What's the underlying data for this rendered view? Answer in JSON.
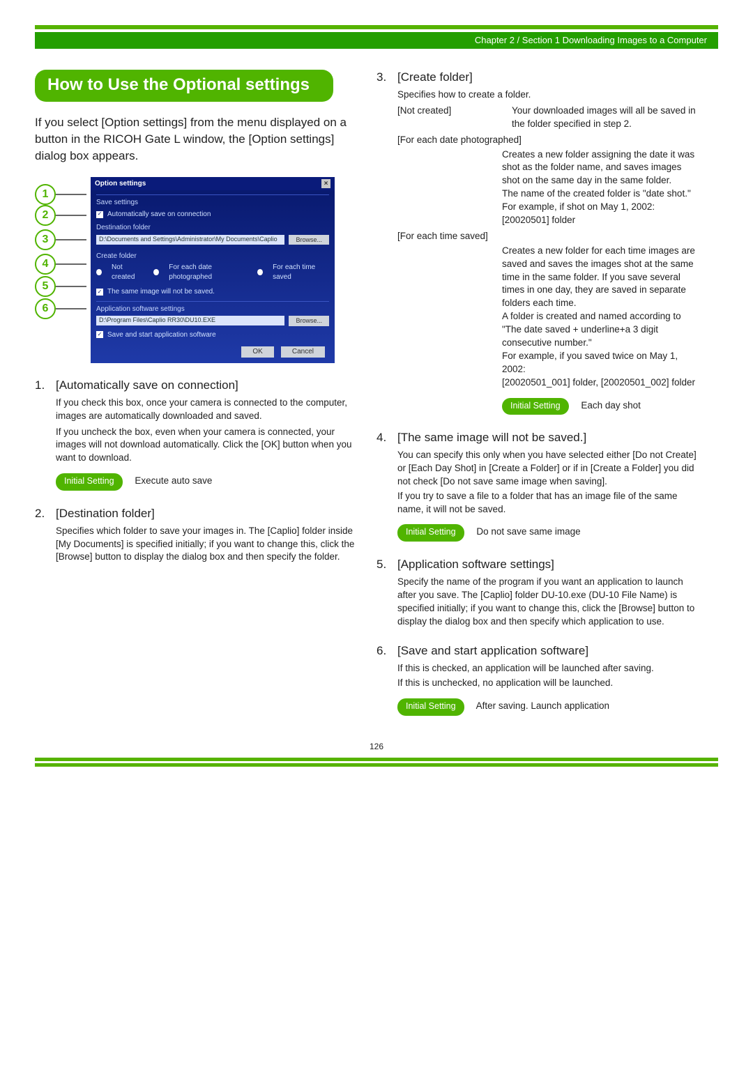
{
  "header": {
    "breadcrumb": "Chapter 2 / Section 1  Downloading Images to a Computer"
  },
  "sectionTitle": "How to Use the Optional settings",
  "intro": "If you select [Option settings] from the menu displayed on a button in the RICOH Gate L window, the [Option settings] dialog box appears.",
  "dialog": {
    "title": "Option settings",
    "groups": {
      "save": {
        "label": "Save settings",
        "autoSave": "Automatically save on connection",
        "destLabel": "Destination folder",
        "destPath": "D:\\Documents and Settings\\Administrator\\My Documents\\Caplio",
        "browse1": "Browse...",
        "createLabel": "Create folder",
        "opt1": "Not created",
        "opt2": "For each date photographed",
        "opt3": "For each time saved",
        "sameImage": "The same image will not be saved."
      },
      "app": {
        "label": "Application software settings",
        "appPath": "D:\\Program Files\\Caplio RR30\\DU10.EXE",
        "browse2": "Browse...",
        "saveStart": "Save and start application software"
      }
    },
    "ok": "OK",
    "cancel": "Cancel"
  },
  "callouts": [
    "1",
    "2",
    "3",
    "4",
    "5",
    "6"
  ],
  "initialSettingLabel": "Initial Setting",
  "left": {
    "item1": {
      "title": "[Automatically save on connection]",
      "p1": "If you check this box, once your camera is connected to the computer, images are automatically downloaded and saved.",
      "p2": "If you uncheck the box, even when your camera is connected, your images will not download automatically. Click the [OK] button when you want to download.",
      "initial": "Execute auto save"
    },
    "item2": {
      "title": "[Destination folder]",
      "p1": "Specifies which folder to save your images in. The [Caplio] folder inside [My Documents] is specified initially; if you want to change this, click the [Browse] button to display the dialog box and then specify the folder."
    }
  },
  "right": {
    "item3": {
      "title": "[Create folder]",
      "lead": "Specifies how to create a folder.",
      "not_created_term": "[Not created]",
      "not_created_desc": "Your downloaded images will all be saved in the folder specified in step 2.",
      "each_date_term": "[For each date photographed]",
      "each_date_desc": "Creates a new folder assigning the date it was shot as the folder name, and saves images shot on the same day in the same folder.\nThe name of the created folder is \"date shot.\"\nFor example, if shot on May 1, 2002: [20020501] folder",
      "each_time_term": "[For each time saved]",
      "each_time_desc": "Creates a new folder for each time images are saved and saves the images shot at the same time in the same folder. If you save several times in one day, they are saved in separate folders each time.\nA folder is created and named according to \"The date saved + underline+a 3 digit consecutive number.\"\nFor example, if you saved twice on May 1, 2002:\n[20020501_001] folder, [20020501_002] folder",
      "initial": "Each day shot"
    },
    "item4": {
      "title": "[The same image will not be saved.]",
      "p1": "You can specify this only when you have selected either [Do not Create] or [Each Day Shot] in [Create a Folder] or if in [Create a Folder] you did not check [Do not save same image when saving].",
      "p2": "If you try to save a file to a folder that has an image file of the same name, it will not be saved.",
      "initial": "Do not save same image"
    },
    "item5": {
      "title": "[Application software settings]",
      "p1": "Specify the name of the program if you want an application to launch after you save. The [Caplio] folder DU-10.exe (DU-10 File Name) is specified initially; if you want to change this, click the [Browse] button to display the dialog box and then specify which application to use."
    },
    "item6": {
      "title": "[Save and start application software]",
      "p1": "If this is checked, an application will be launched after saving.",
      "p2": "If this is unchecked, no application will be launched.",
      "initial": "After saving. Launch application"
    }
  },
  "pageNumber": "126"
}
